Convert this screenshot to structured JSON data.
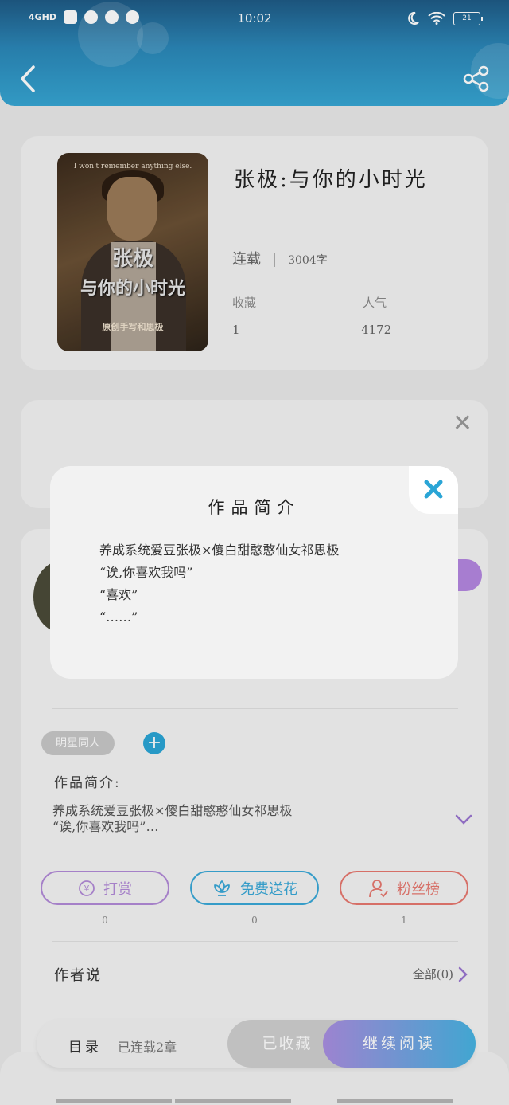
{
  "status_bar": {
    "network": "4GHD",
    "time": "10:02",
    "battery": "21"
  },
  "book": {
    "title": "张极:与你的小时光",
    "cover_text_top": "I won't remember anything else.",
    "cover_title_1": "张极",
    "cover_title_2": "与你的小时光",
    "cover_credit": "原创手写和思极",
    "status": "连载",
    "word_count": "3004字",
    "favorites_label": "收藏",
    "favorites_value": "1",
    "popularity_label": "人气",
    "popularity_value": "4172"
  },
  "details": {
    "tag": "明星同人",
    "intro_label": "作品简介:",
    "intro_line1": "养成系统爱豆张极×傻白甜憨憨仙女祁思极",
    "intro_line2": "“诶,你喜欢我吗”…",
    "actions": [
      {
        "label": "打赏",
        "count": "0",
        "color": "#b28ad8"
      },
      {
        "label": "免费送花",
        "count": "0",
        "color": "#3aa8d8"
      },
      {
        "label": "粉丝榜",
        "count": "1",
        "color": "#e7786f"
      }
    ],
    "author_say": "作者说",
    "author_all": "全部(0)"
  },
  "bottom_bar": {
    "toc": "目录",
    "serial": "已连载2章",
    "collected": "已收藏",
    "continue": "继续阅读"
  },
  "modal": {
    "title": "作品简介",
    "line1": "养成系统爱豆张极×傻白甜憨憨仙女祁思极",
    "line2": "“诶,你喜欢我吗”",
    "line3": "“喜欢”",
    "line4": "“……”"
  },
  "colors": {
    "accent_blue": "#2aa5d6",
    "accent_purple": "#b487e0"
  }
}
